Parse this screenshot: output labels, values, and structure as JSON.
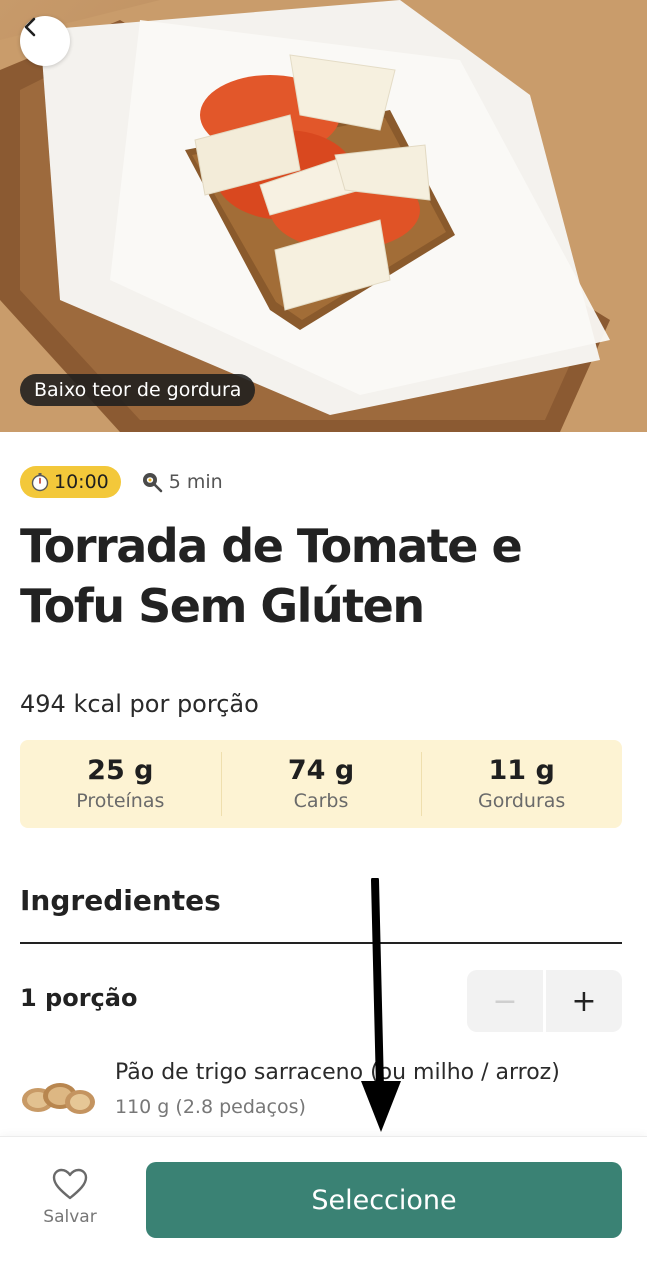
{
  "hero": {
    "tag": "Baixo teor de gordura",
    "back_icon": "chevron-left-icon"
  },
  "meta": {
    "time": "10:00",
    "time_icon": "stopwatch-icon",
    "prep": "5 min",
    "prep_icon": "cooking-pan-icon"
  },
  "recipe": {
    "title": "Torrada de Tomate e Tofu Sem Glúten",
    "kcal": "494 kcal por porção"
  },
  "macros": [
    {
      "value": "25 g",
      "label": "Proteínas"
    },
    {
      "value": "74 g",
      "label": "Carbs"
    },
    {
      "value": "11 g",
      "label": "Gorduras"
    }
  ],
  "ingredients": {
    "heading": "Ingredientes",
    "servings": "1 porção",
    "minus": "−",
    "plus": "+",
    "items": [
      {
        "name": "Pão de trigo sarraceno (ou milho / arroz)",
        "qty": "110 g (2.8 pedaços)"
      }
    ]
  },
  "bottom": {
    "save_label": "Salvar",
    "select_label": "Seleccione"
  },
  "colors": {
    "accent": "#3a8274",
    "badge": "#f3c83a",
    "macro_bg": "#fdf3d3"
  }
}
